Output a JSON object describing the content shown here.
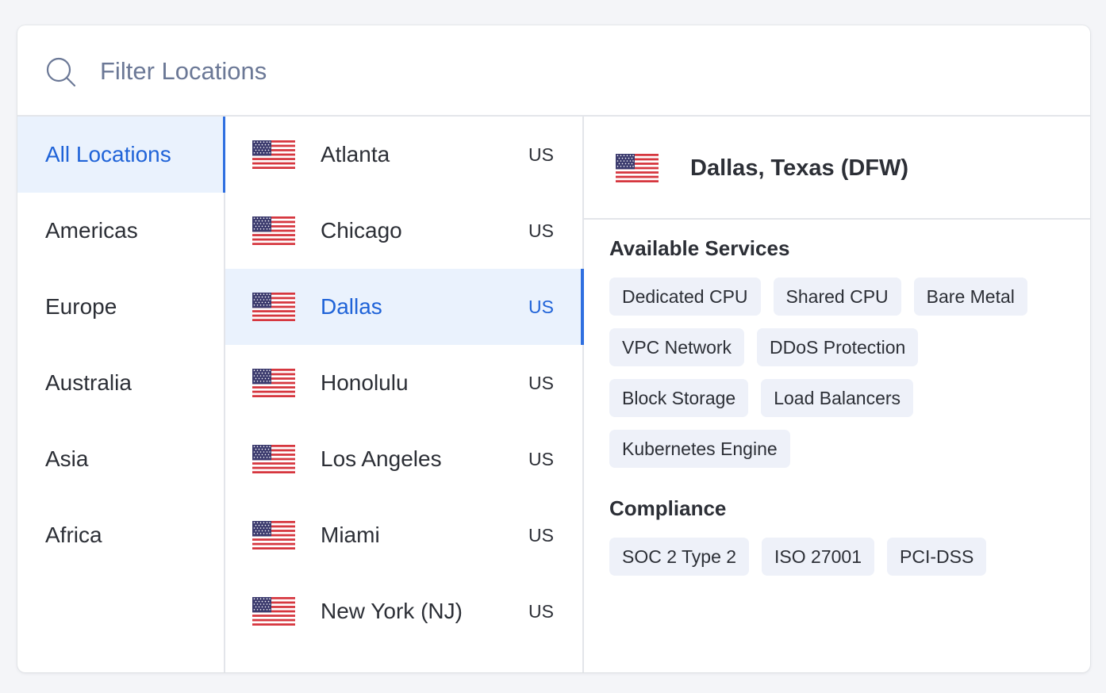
{
  "search": {
    "placeholder": "Filter Locations",
    "value": ""
  },
  "regions": [
    {
      "label": "All Locations",
      "active": true
    },
    {
      "label": "Americas",
      "active": false
    },
    {
      "label": "Europe",
      "active": false
    },
    {
      "label": "Australia",
      "active": false
    },
    {
      "label": "Asia",
      "active": false
    },
    {
      "label": "Africa",
      "active": false
    }
  ],
  "cities": [
    {
      "name": "Atlanta",
      "country": "US",
      "flag": "us-flag-icon",
      "active": false
    },
    {
      "name": "Chicago",
      "country": "US",
      "flag": "us-flag-icon",
      "active": false
    },
    {
      "name": "Dallas",
      "country": "US",
      "flag": "us-flag-icon",
      "active": true
    },
    {
      "name": "Honolulu",
      "country": "US",
      "flag": "us-flag-icon",
      "active": false
    },
    {
      "name": "Los Angeles",
      "country": "US",
      "flag": "us-flag-icon",
      "active": false
    },
    {
      "name": "Miami",
      "country": "US",
      "flag": "us-flag-icon",
      "active": false
    },
    {
      "name": "New York (NJ)",
      "country": "US",
      "flag": "us-flag-icon",
      "active": false
    }
  ],
  "details": {
    "title": "Dallas, Texas (DFW)",
    "flag": "us-flag-icon",
    "services_title": "Available Services",
    "services": [
      "Dedicated CPU",
      "Shared CPU",
      "Bare Metal",
      "VPC Network",
      "DDoS Protection",
      "Block Storage",
      "Load Balancers",
      "Kubernetes Engine"
    ],
    "compliance_title": "Compliance",
    "compliance": [
      "SOC 2 Type 2",
      "ISO 27001",
      "PCI-DSS"
    ]
  },
  "colors": {
    "accent": "#2f6fe0",
    "active_text": "#1f63d8",
    "active_bg": "#eaf2fd",
    "chip_bg": "#eef1f9",
    "text": "#2c2f36",
    "placeholder": "#6b7896",
    "border": "#e3e5ea",
    "flag_red": "#d6373f",
    "flag_blue": "#3c3b6e"
  }
}
